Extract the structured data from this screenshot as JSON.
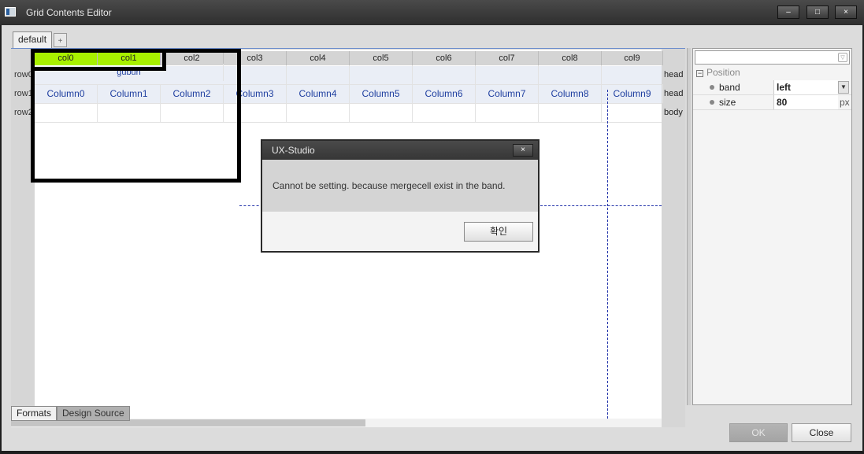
{
  "window": {
    "title": "Grid Contents Editor",
    "minimize": "–",
    "maximize": "□",
    "close": "×"
  },
  "tabs": {
    "active": "default",
    "add": "+"
  },
  "grid": {
    "columns": [
      "col0",
      "col1",
      "col2",
      "col3",
      "col4",
      "col5",
      "col6",
      "col7",
      "col8",
      "col9"
    ],
    "rows": [
      "row0",
      "row1",
      "row2"
    ],
    "bands": [
      "head",
      "head",
      "body"
    ],
    "row0_merged_text": "gubun",
    "row1_cells": [
      "Column0",
      "Column1",
      "Column2",
      "Column3",
      "Column4",
      "Column5",
      "Column6",
      "Column7",
      "Column8",
      "Column9"
    ]
  },
  "bottom_tabs": {
    "formats": "Formats",
    "design_source": "Design Source"
  },
  "properties": {
    "section": "Position",
    "collapse": "⊟",
    "band": {
      "label": "band",
      "value": "left"
    },
    "size": {
      "label": "size",
      "value": "80",
      "unit": "px"
    }
  },
  "buttons": {
    "ok": "OK",
    "close": "Close"
  },
  "dialog": {
    "title": "UX-Studio",
    "message": "Cannot be setting. because mergecell exist in the band.",
    "confirm": "확인",
    "close": "×"
  }
}
